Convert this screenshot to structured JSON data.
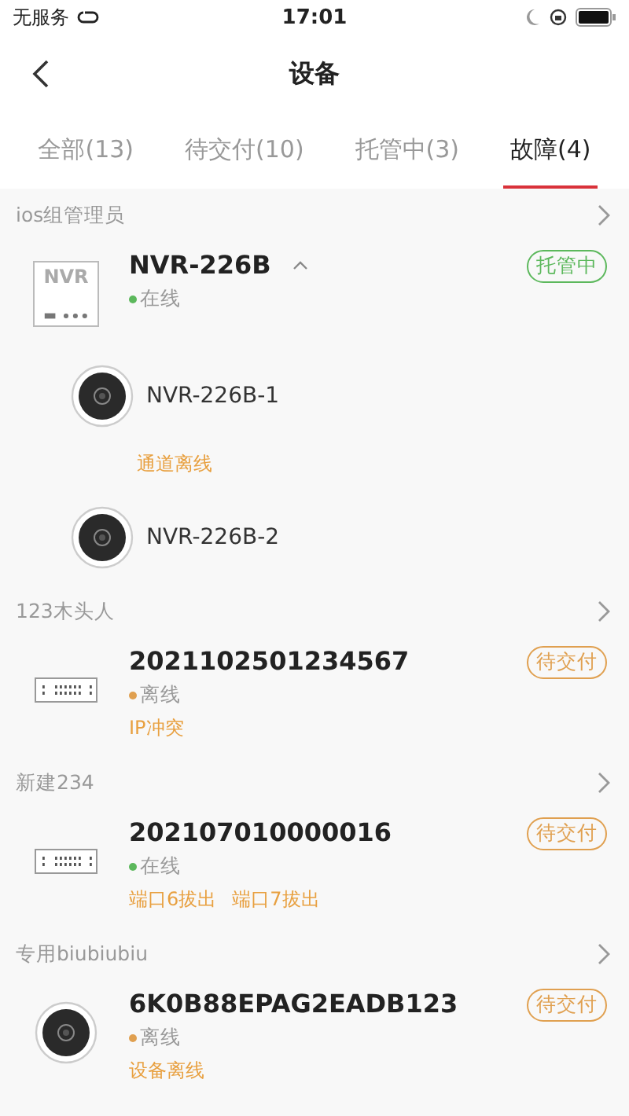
{
  "status_bar": {
    "carrier": "无服务",
    "time": "17:01"
  },
  "nav": {
    "title": "设备"
  },
  "tabs": [
    {
      "label": "全部(13)",
      "selected": false
    },
    {
      "label": "待交付(10)",
      "selected": false
    },
    {
      "label": "托管中(3)",
      "selected": false
    },
    {
      "label": "故障(4)",
      "selected": true
    }
  ],
  "groups": [
    {
      "owner": "ios组管理员",
      "devices": [
        {
          "kind": "nvr",
          "icon_label": "NVR",
          "name": "NVR-226B",
          "expanded": true,
          "status": {
            "label": "在线",
            "online": true
          },
          "badge": {
            "label": "托管中",
            "color": "#5cb85c"
          },
          "channels": [
            {
              "name": "NVR-226B-1",
              "alerts": [
                "通道离线"
              ]
            },
            {
              "name": "NVR-226B-2"
            }
          ]
        }
      ]
    },
    {
      "owner": "123木头人",
      "devices": [
        {
          "kind": "switch",
          "name": "2021102501234567",
          "status": {
            "label": "离线",
            "online": false
          },
          "badge": {
            "label": "待交付",
            "color": "#e0a050"
          },
          "alerts": [
            "IP冲突"
          ]
        }
      ]
    },
    {
      "owner": "新建234",
      "devices": [
        {
          "kind": "switch",
          "name": "202107010000016",
          "status": {
            "label": "在线",
            "online": true
          },
          "badge": {
            "label": "待交付",
            "color": "#e0a050"
          },
          "alerts": [
            "端口6拔出",
            "端口7拔出"
          ]
        }
      ]
    },
    {
      "owner": "专用biubiubiu",
      "devices": [
        {
          "kind": "camera",
          "name": "6K0B88EPAG2EADB123",
          "status": {
            "label": "离线",
            "online": false
          },
          "badge": {
            "label": "待交付",
            "color": "#e0a050"
          },
          "alerts": [
            "设备离线"
          ]
        }
      ]
    }
  ]
}
